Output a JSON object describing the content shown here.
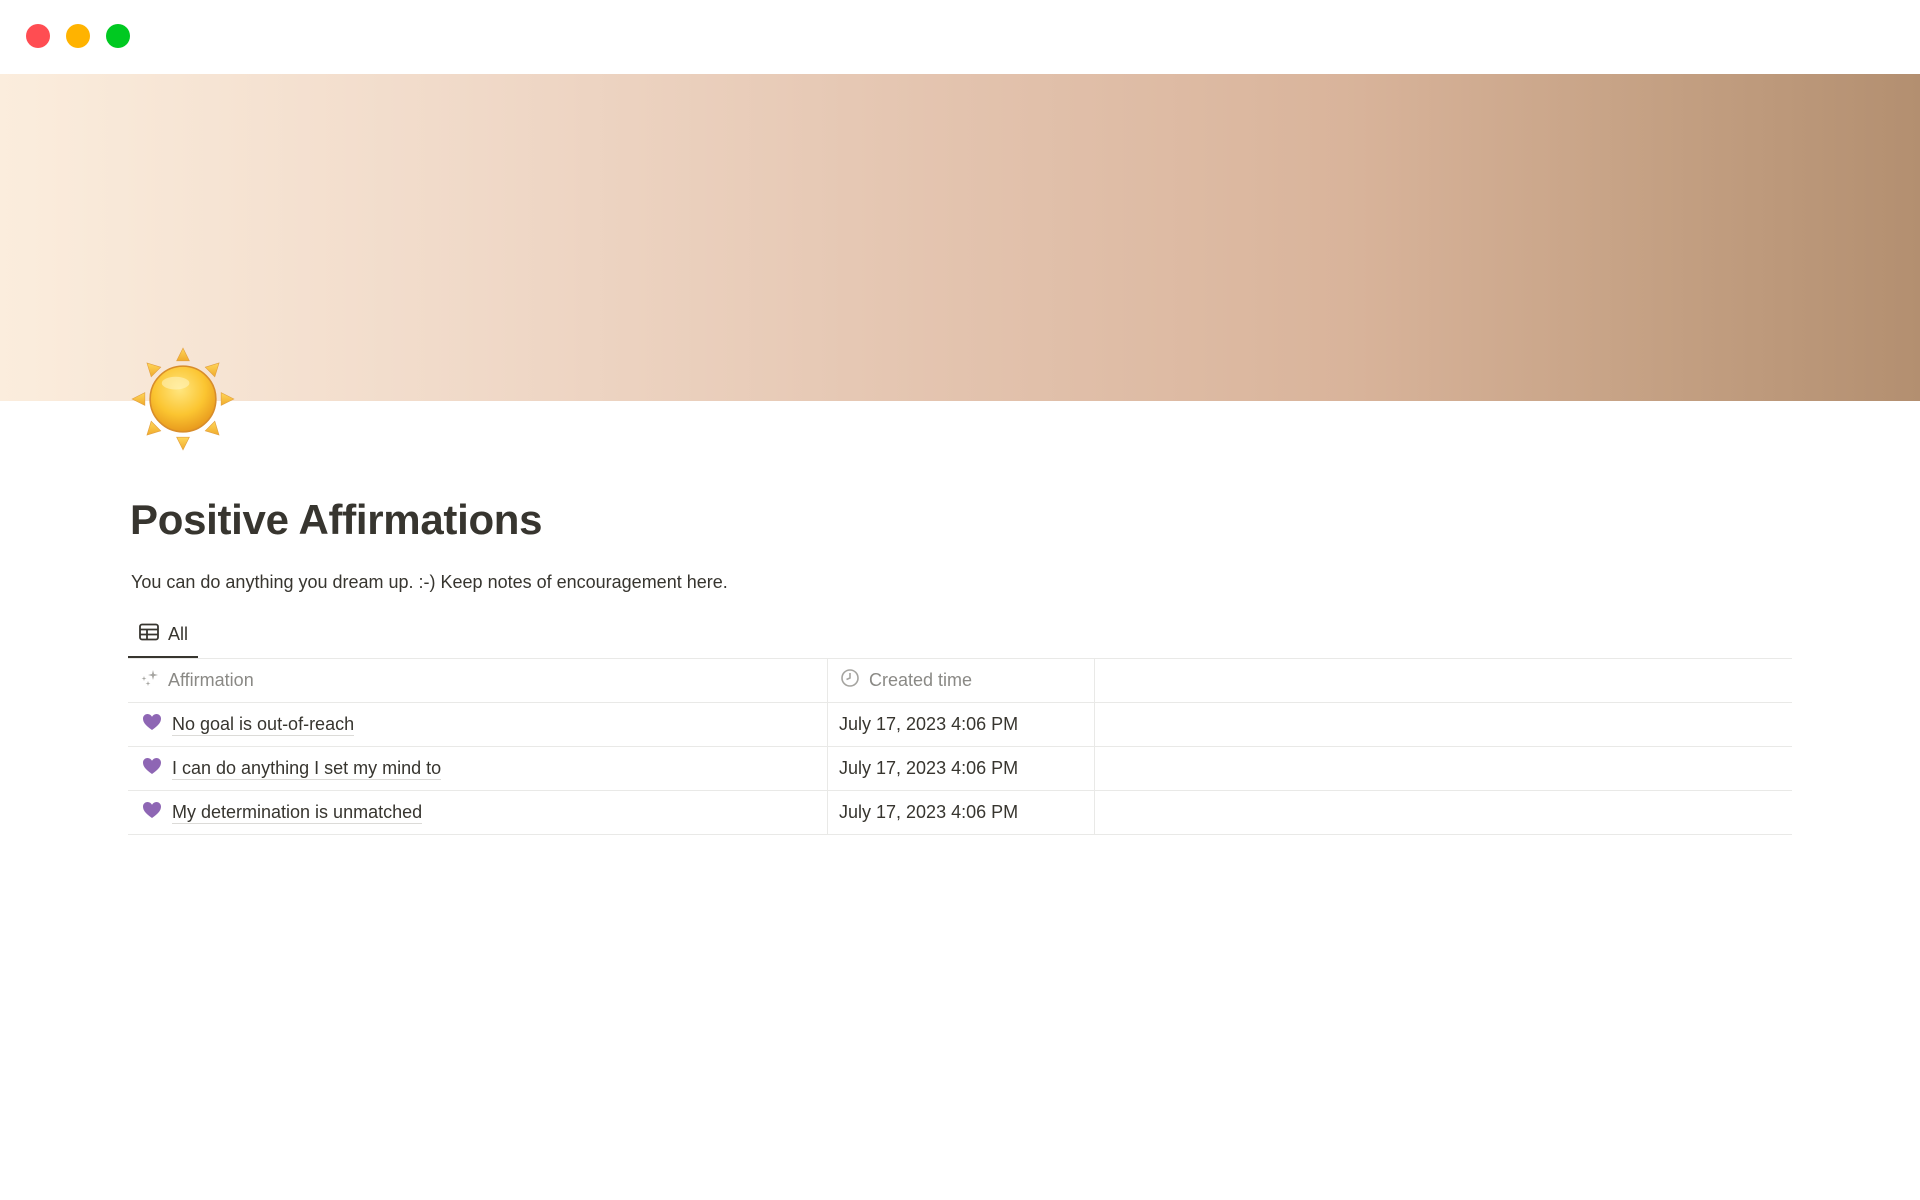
{
  "window": {
    "controls": [
      "close",
      "minimize",
      "maximize"
    ]
  },
  "cover": {
    "gradient_colors": [
      "#fbeddd",
      "#e3c3ae",
      "#b38f70"
    ]
  },
  "page": {
    "icon": "sun-emoji",
    "title": "Positive Affirmations",
    "description": "You can do anything you dream up. :-) Keep notes of encouragement here."
  },
  "views": {
    "tabs": [
      {
        "label": "All",
        "icon": "table-icon",
        "active": true
      }
    ]
  },
  "table": {
    "columns": [
      {
        "label": "Affirmation",
        "icon": "sparkles-icon"
      },
      {
        "label": "Created time",
        "icon": "clock-icon"
      }
    ],
    "rows": [
      {
        "icon": "purple-heart",
        "affirmation": "No goal is out-of-reach",
        "created_time": "July 17, 2023 4:06 PM"
      },
      {
        "icon": "purple-heart",
        "affirmation": "I can do anything I set my mind to",
        "created_time": "July 17, 2023 4:06 PM"
      },
      {
        "icon": "purple-heart",
        "affirmation": "My determination is unmatched",
        "created_time": "July 17, 2023 4:06 PM"
      }
    ]
  },
  "colors": {
    "text": "#37352f",
    "muted": "#8a8985",
    "heart": "#8e66b4",
    "border": "#e9e9e7"
  }
}
